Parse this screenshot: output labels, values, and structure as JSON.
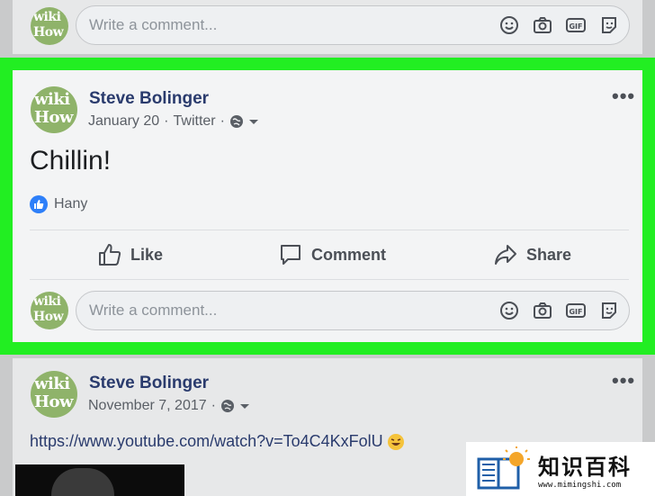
{
  "top_card": {
    "avatar": {
      "line1": "wiki",
      "line2": "How"
    },
    "comment_placeholder": "Write a comment..."
  },
  "post": {
    "author": "Steve Bolinger",
    "date": "January 20",
    "via": "Twitter",
    "separator": "·",
    "avatar": {
      "line1": "wiki",
      "line2": "How"
    },
    "text": "Chillin!",
    "reaction_name": "Hany",
    "more_label": "•••",
    "actions": {
      "like": "Like",
      "comment": "Comment",
      "share": "Share"
    },
    "comment_placeholder": "Write a comment...",
    "highlight_color": "#22ee22"
  },
  "next_post": {
    "author": "Steve Bolinger",
    "date": "November 7, 2017",
    "separator": "·",
    "avatar": {
      "line1": "wiki",
      "line2": "How"
    },
    "more_label": "•••",
    "link": "https://www.youtube.com/watch?v=To4C4KxFolU"
  },
  "watermark": {
    "brand": "知识百科",
    "url": "www.mimingshi.com"
  },
  "colors": {
    "page_bg": "#c9cacb",
    "name": "#2a3b6d",
    "like_blue": "#2d7ff9"
  }
}
